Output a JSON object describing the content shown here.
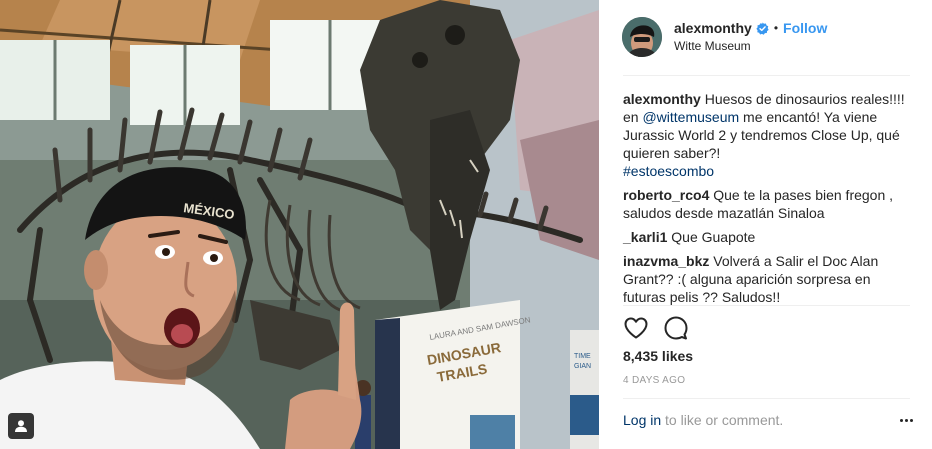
{
  "post": {
    "author": {
      "username": "alexmonthy",
      "verified": true,
      "follow_label": "Follow",
      "location": "Witte Museum",
      "avatar_icon": "user-avatar"
    },
    "caption": {
      "user": "alexmonthy",
      "text_before": " Huesos de dinosaurios reales!!!! en ",
      "mention": "@wittemuseum",
      "text_after": " me encantó! Ya viene Jurassic World 2 y tendremos Close Up, qué quieren saber?!",
      "hashtag": "#estoescombo"
    },
    "comments": [
      {
        "user": "roberto_rco4",
        "text": " Que te la pases bien fregon , saludos desde mazatlán Sinaloa"
      },
      {
        "user": "_karli1",
        "text": " Que Guapote"
      },
      {
        "user": "inazvma_bkz",
        "text": " Volverá a Salir el Doc Alan Grant?? :( alguna aparición sorpresa en futuras pelis ?? Saludos!!"
      }
    ],
    "likes": "8,435 likes",
    "timestamp": "4 DAYS AGO",
    "login_link": "Log in",
    "login_suffix": " to like or comment."
  },
  "photo": {
    "hat_text": "MÉXICO",
    "sign_header": "LAURA AND SAM DAWSON",
    "sign_title_1": "DINOSAUR",
    "sign_title_2": "TRAILS",
    "sign2_text_1": "TIME",
    "sign2_text_2": "GIAN"
  },
  "colors": {
    "link_blue": "#3897f0",
    "mention_blue": "#003569",
    "muted": "#999999",
    "text": "#262626"
  },
  "icons": [
    "user-tag-icon",
    "verified-badge-icon",
    "heart-icon",
    "comment-icon",
    "more-options-icon"
  ]
}
